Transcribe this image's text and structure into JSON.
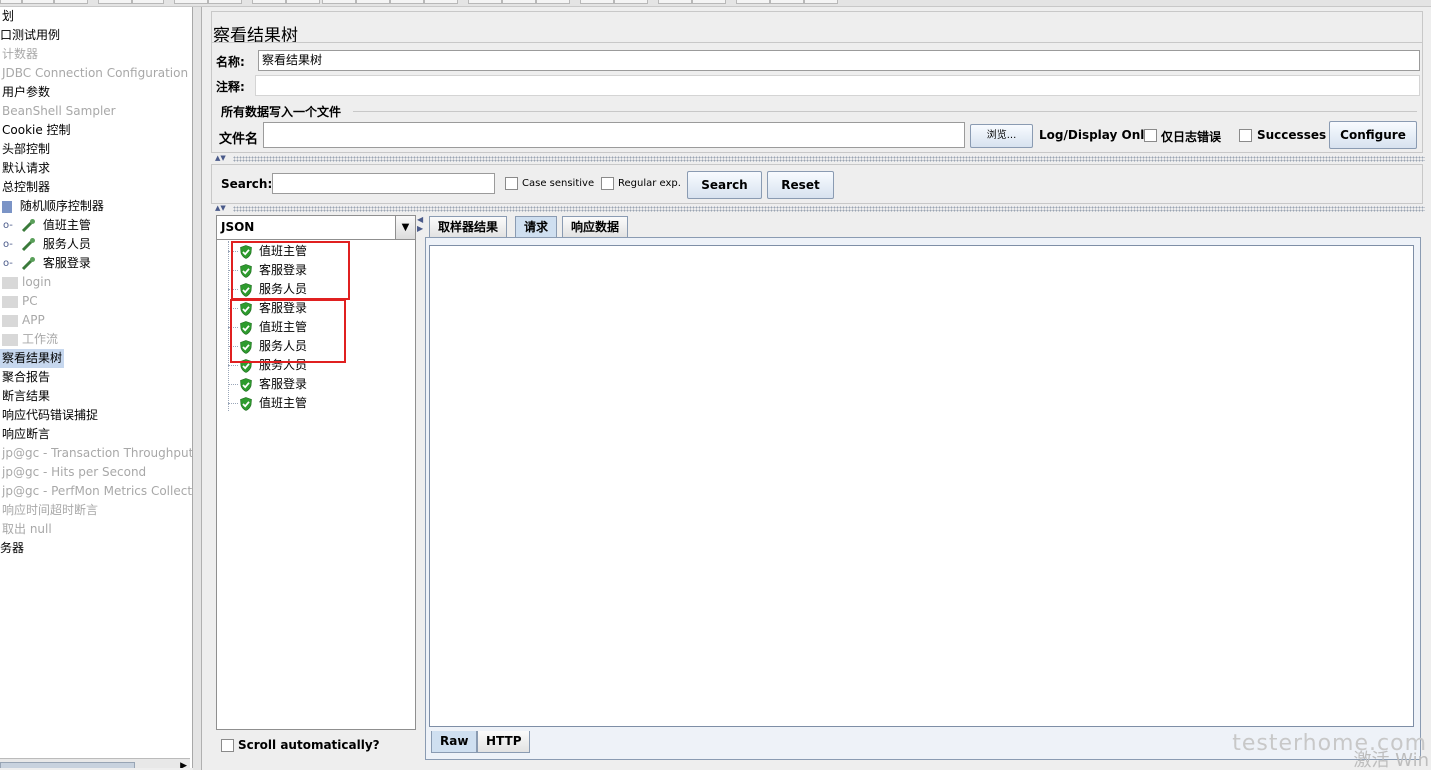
{
  "left_tree": {
    "items": [
      {
        "label": "划",
        "state": "normal"
      },
      {
        "label": "口测试用例",
        "state": "normal"
      },
      {
        "label": "计数器",
        "state": "disabled"
      },
      {
        "label": "JDBC Connection Configuration",
        "state": "disabled"
      },
      {
        "label": "用户参数",
        "state": "normal"
      },
      {
        "label": "BeanShell Sampler",
        "state": "disabled"
      },
      {
        "label": "Cookie 控制",
        "state": "normal"
      },
      {
        "label": "头部控制",
        "state": "normal"
      },
      {
        "label": "默认请求",
        "state": "normal"
      },
      {
        "label": "总控制器",
        "state": "normal"
      },
      {
        "label": "随机顺序控制器",
        "state": "normal"
      },
      {
        "label": "值班主管",
        "state": "normal"
      },
      {
        "label": "服务人员",
        "state": "normal"
      },
      {
        "label": "客服登录",
        "state": "normal"
      },
      {
        "label": "login",
        "state": "disabled"
      },
      {
        "label": "PC",
        "state": "disabled"
      },
      {
        "label": "APP",
        "state": "disabled"
      },
      {
        "label": "工作流",
        "state": "disabled"
      },
      {
        "label": "察看结果树",
        "state": "selected"
      },
      {
        "label": "聚合报告",
        "state": "normal"
      },
      {
        "label": "断言结果",
        "state": "normal"
      },
      {
        "label": "响应代码错误捕捉",
        "state": "normal"
      },
      {
        "label": "响应断言",
        "state": "normal"
      },
      {
        "label": "jp@gc - Transaction Throughput vs",
        "state": "disabled"
      },
      {
        "label": "jp@gc - Hits per Second",
        "state": "disabled"
      },
      {
        "label": "jp@gc - PerfMon Metrics Collector",
        "state": "disabled"
      },
      {
        "label": "响应时间超时断言",
        "state": "disabled"
      },
      {
        "label": "取出 null",
        "state": "disabled"
      },
      {
        "label": "务器",
        "state": "normal"
      }
    ]
  },
  "panel": {
    "title": "察看结果树",
    "name_label": "名称:",
    "name_value": "察看结果树",
    "comment_label": "注释:",
    "comment_value": "",
    "file_section_title": "所有数据写入一个文件",
    "filename_label": "文件名",
    "filename_value": "",
    "browse_button": "浏览...",
    "log_display_only": "Log/Display Only:",
    "errors_only_label": "仅日志错误",
    "successes_label": "Successes",
    "configure_button": "Configure"
  },
  "search": {
    "label": "Search:",
    "value": "",
    "case_sensitive": "Case sensitive",
    "regular_exp": "Regular exp.",
    "search_button": "Search",
    "reset_button": "Reset"
  },
  "results": {
    "renderer": "JSON",
    "rows": [
      "值班主管",
      "客服登录",
      "服务人员",
      "客服登录",
      "值班主管",
      "服务人员",
      "服务人员",
      "客服登录",
      "值班主管"
    ],
    "scroll_auto": "Scroll automatically?"
  },
  "tabs": {
    "top": [
      "取样器结果",
      "请求",
      "响应数据"
    ],
    "active_top": "请求",
    "bottom": [
      "Raw",
      "HTTP"
    ],
    "active_bottom": "Raw"
  },
  "watermark": {
    "site": "testerhome.com",
    "activate": "激活 Win"
  },
  "colors": {
    "selection": "#c6d7ee",
    "success_shield": "#2e9b2e",
    "highlight_box": "#e02020",
    "disabled_text": "#a8a8a8"
  }
}
